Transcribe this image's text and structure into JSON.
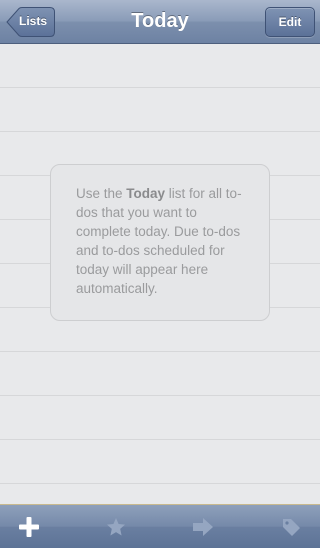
{
  "navbar": {
    "title": "Today",
    "back_label": "Lists",
    "edit_label": "Edit"
  },
  "empty_state": {
    "text_before": "Use the ",
    "text_bold": "Today",
    "text_after": " list for all to-dos that you want to complete today. Due to-dos and to-dos scheduled for today will appear here automatically."
  },
  "toolbar": {
    "items": [
      {
        "icon": "plus-icon",
        "enabled": true
      },
      {
        "icon": "star-icon",
        "enabled": false
      },
      {
        "icon": "arrow-right-icon",
        "enabled": false
      },
      {
        "icon": "tag-icon",
        "enabled": false
      }
    ]
  },
  "colors": {
    "nav_bar": "#7c8fad",
    "background": "#e8e9eb",
    "empty_text": "#9a9b9d"
  }
}
